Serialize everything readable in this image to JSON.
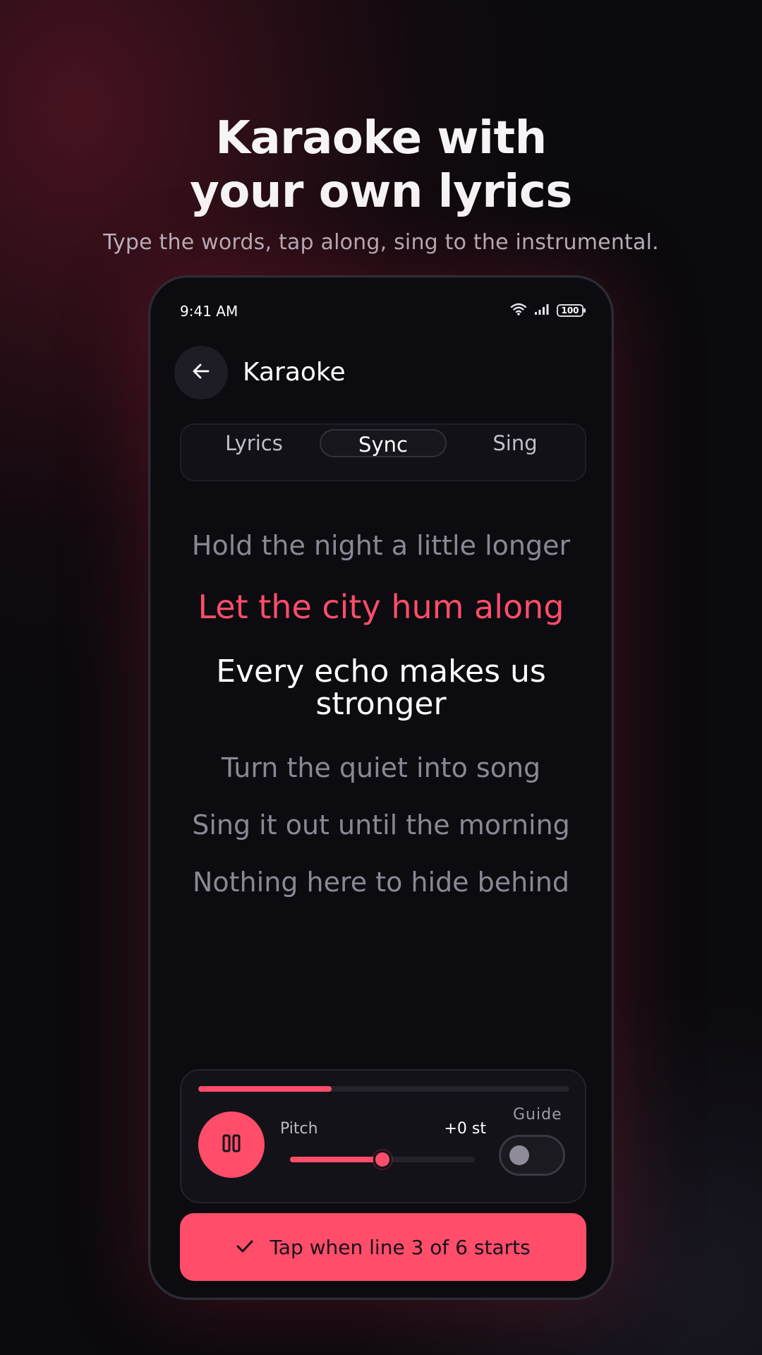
{
  "hero": {
    "title_line1": "Karaoke with",
    "title_line2": "your own lyrics",
    "subtitle": "Type the words, tap along, sing to the instrumental."
  },
  "status_bar": {
    "time": "9:41 AM",
    "battery": "100",
    "icons": [
      "wifi-icon",
      "signal-icon",
      "battery-icon"
    ]
  },
  "header": {
    "back_icon": "arrow-left-icon",
    "title": "Karaoke"
  },
  "tabs": [
    {
      "label": "Lyrics",
      "active": false
    },
    {
      "label": "Sync",
      "active": true
    },
    {
      "label": "Sing",
      "active": false
    }
  ],
  "lyrics": [
    {
      "text": "Hold the night a little longer",
      "state": "past"
    },
    {
      "text": "Let the city hum along",
      "state": "current"
    },
    {
      "text": "Every echo makes us stronger",
      "state": "next",
      "display_line1": "Every echo makes us",
      "display_line2": "stronger"
    },
    {
      "text": "Turn the quiet into song",
      "state": "upcoming"
    },
    {
      "text": "Sing it out until the morning",
      "state": "upcoming"
    },
    {
      "text": "Nothing here to hide behind",
      "state": "upcoming"
    }
  ],
  "player": {
    "progress_fraction": 0.36,
    "play_state": "playing",
    "pause_icon": "pause-icon",
    "pitch_label": "Pitch",
    "pitch_value": "+0 st",
    "pitch_slider_fraction": 0.5,
    "guide_label": "Guide",
    "guide_enabled": false
  },
  "cta": {
    "icon": "check-icon",
    "label": "Tap when line 3 of 6 starts"
  },
  "colors": {
    "accent": "#ff4d6a",
    "background": "#0b0a0e",
    "muted_text": "#8b8794"
  }
}
